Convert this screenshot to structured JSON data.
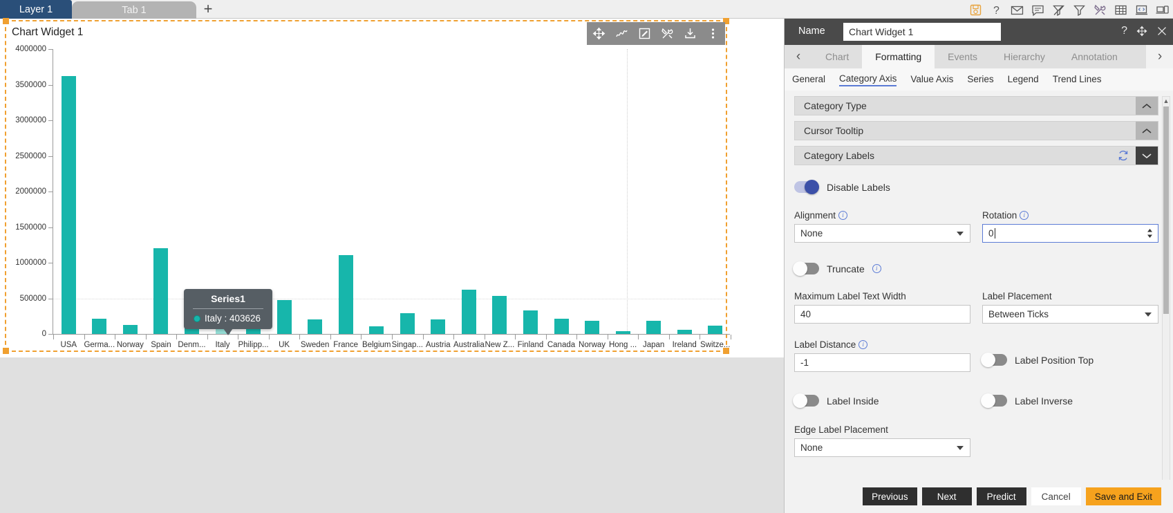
{
  "topbar": {
    "tabs": [
      {
        "label": "Layer 1",
        "active": true
      },
      {
        "label": "Tab 1",
        "active": false
      }
    ],
    "add_label": "+",
    "icons": [
      {
        "name": "save-icon",
        "title": "Save"
      },
      {
        "name": "help-icon",
        "title": "Help"
      },
      {
        "name": "mail-icon",
        "title": "Mail"
      },
      {
        "name": "comment-icon",
        "title": "Comment"
      },
      {
        "name": "filter-off-icon",
        "title": "Clear Filter"
      },
      {
        "name": "filter-icon",
        "title": "Filter"
      },
      {
        "name": "tools-icon",
        "title": "Tools"
      },
      {
        "name": "table-icon",
        "title": "Table"
      },
      {
        "name": "code-icon",
        "title": "Code"
      },
      {
        "name": "device-icon",
        "title": "Devices"
      }
    ]
  },
  "widget": {
    "title": "Chart Widget 1",
    "toolbar_icons": [
      {
        "name": "move-icon"
      },
      {
        "name": "trend-icon"
      },
      {
        "name": "edit-icon"
      },
      {
        "name": "tools-icon"
      },
      {
        "name": "download-icon"
      },
      {
        "name": "more-vertical-icon"
      }
    ]
  },
  "tooltip": {
    "title": "Series1",
    "text": "Italy : 403626",
    "dot_color": "#17b6ab"
  },
  "panel": {
    "name_label": "Name",
    "name_value": "Chart Widget 1",
    "header_icons": [
      {
        "name": "help-icon",
        "glyph": "?"
      },
      {
        "name": "move-icon"
      },
      {
        "name": "close-icon"
      }
    ],
    "tabs": [
      {
        "label": "Chart",
        "active": false
      },
      {
        "label": "Formatting",
        "active": true
      },
      {
        "label": "Events",
        "active": false
      },
      {
        "label": "Hierarchy",
        "active": false
      },
      {
        "label": "Annotation",
        "active": false
      }
    ],
    "prev_arrow": "‹",
    "next_arrow": "›",
    "subtabs": [
      {
        "label": "General",
        "active": false
      },
      {
        "label": "Category Axis",
        "active": true
      },
      {
        "label": "Value Axis",
        "active": false
      },
      {
        "label": "Series",
        "active": false
      },
      {
        "label": "Legend",
        "active": false
      },
      {
        "label": "Trend Lines",
        "active": false
      }
    ],
    "accordions": [
      {
        "title": "Category Type",
        "expanded": false
      },
      {
        "title": "Cursor Tooltip",
        "expanded": false
      },
      {
        "title": "Category Labels",
        "expanded": true
      }
    ],
    "form": {
      "disable_labels": {
        "label": "Disable Labels",
        "on": true
      },
      "alignment": {
        "label": "Alignment",
        "value": "None",
        "has_info": true
      },
      "rotation": {
        "label": "Rotation",
        "value": "0",
        "has_info": true,
        "focused": true
      },
      "truncate": {
        "label": "Truncate",
        "on": false,
        "has_info": true
      },
      "max_label_text_width": {
        "label": "Maximum Label Text Width",
        "value": "40"
      },
      "label_placement": {
        "label": "Label Placement",
        "value": "Between Ticks"
      },
      "label_distance": {
        "label": "Label Distance",
        "value": "-1",
        "has_info": true
      },
      "label_position_top": {
        "label": "Label Position Top",
        "on": false
      },
      "label_inside": {
        "label": "Label Inside",
        "on": false
      },
      "label_inverse": {
        "label": "Label Inverse",
        "on": false
      },
      "edge_label_placement": {
        "label": "Edge Label Placement",
        "value": "None"
      }
    },
    "footer_buttons": [
      {
        "label": "Previous",
        "style": "dark"
      },
      {
        "label": "Next",
        "style": "dark"
      },
      {
        "label": "Predict",
        "style": "dark"
      },
      {
        "label": "Cancel",
        "style": "light"
      },
      {
        "label": "Save and Exit",
        "style": "accent"
      }
    ]
  },
  "chart_data": {
    "type": "bar",
    "title": "",
    "xlabel": "",
    "ylabel": "",
    "ylim": [
      0,
      4000000
    ],
    "yticks": [
      0,
      500000,
      1000000,
      1500000,
      2000000,
      2500000,
      3000000,
      3500000,
      4000000
    ],
    "ytick_labels": [
      "0",
      "500000",
      "1000000",
      "1500000",
      "2000000",
      "2500000",
      "3000000",
      "3500000",
      "4000000"
    ],
    "grid": true,
    "legend": false,
    "series_name": "Series1",
    "bar_color": "#17b6ab",
    "highlight_color": "#96e0d8",
    "highlight_index": 5,
    "categories": [
      "USA",
      "Germa...",
      "Norway",
      "Spain",
      "Denm...",
      "Italy",
      "Philipp...",
      "UK",
      "Sweden",
      "France",
      "Belgium",
      "Singap...",
      "Austria",
      "Australia",
      "New Z...",
      "Finland",
      "Canada",
      "Norway",
      "Hong ...",
      "Japan",
      "Ireland",
      "Switze..."
    ],
    "values": [
      3620000,
      213000,
      123000,
      1208000,
      248000,
      403626,
      93000,
      480000,
      200000,
      1110000,
      108000,
      290000,
      200000,
      620000,
      535000,
      330000,
      215000,
      180000,
      40000,
      180000,
      55000,
      120000
    ]
  }
}
